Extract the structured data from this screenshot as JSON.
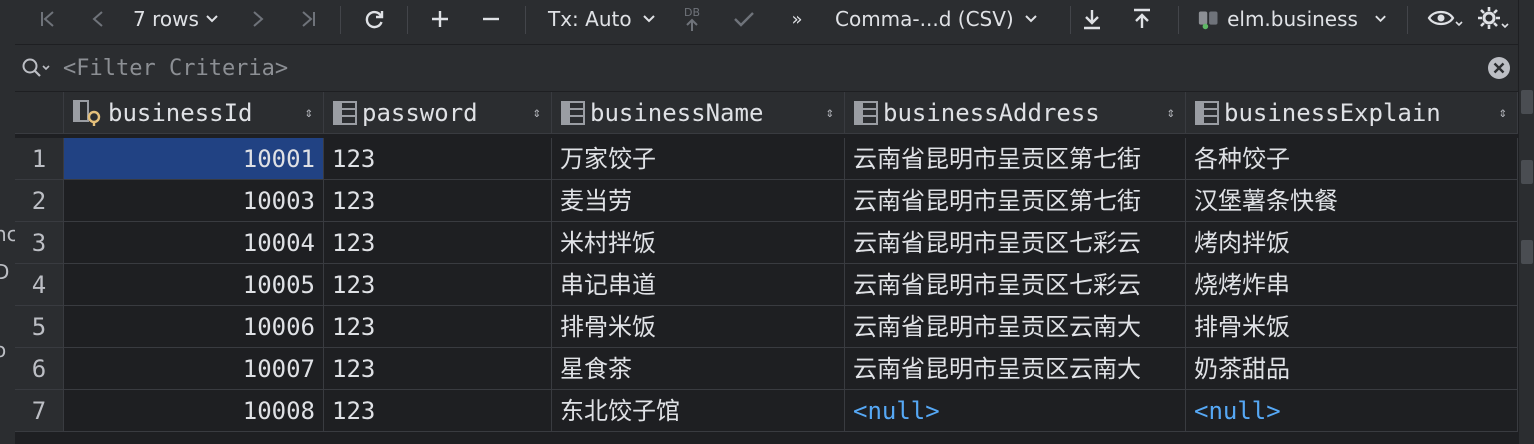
{
  "toolbar": {
    "rows_label": "7 rows",
    "tx_label": "Tx: Auto",
    "db_label": "DB",
    "more_label": "»",
    "format_label": "Comma-...d (CSV)",
    "datasource_label": "elm.business"
  },
  "filter": {
    "placeholder": "<Filter Criteria>"
  },
  "columns": [
    {
      "label": "businessId",
      "icon": "primary-key-column-icon"
    },
    {
      "label": "password",
      "icon": "column-icon"
    },
    {
      "label": "businessName",
      "icon": "column-icon"
    },
    {
      "label": "businessAddress",
      "icon": "column-icon"
    },
    {
      "label": "businessExplain",
      "icon": "column-icon"
    }
  ],
  "rows": [
    {
      "n": "1",
      "id": "10001",
      "pw": "123",
      "name": "万家饺子",
      "addr": "云南省昆明市呈贡区第七街",
      "explain": "各种饺子"
    },
    {
      "n": "2",
      "id": "10003",
      "pw": "123",
      "name": "麦当劳",
      "addr": "云南省昆明市呈贡区第七街",
      "explain": "汉堡薯条快餐"
    },
    {
      "n": "3",
      "id": "10004",
      "pw": "123",
      "name": "米村拌饭",
      "addr": "云南省昆明市呈贡区七彩云",
      "explain": "烤肉拌饭"
    },
    {
      "n": "4",
      "id": "10005",
      "pw": "123",
      "name": "串记串道",
      "addr": "云南省昆明市呈贡区七彩云",
      "explain": "烧烤炸串"
    },
    {
      "n": "5",
      "id": "10006",
      "pw": "123",
      "name": "排骨米饭",
      "addr": "云南省昆明市呈贡区云南大",
      "explain": "排骨米饭"
    },
    {
      "n": "6",
      "id": "10007",
      "pw": "123",
      "name": "星食茶",
      "addr": "云南省昆明市呈贡区云南大",
      "explain": "奶茶甜品"
    },
    {
      "n": "7",
      "id": "10008",
      "pw": "123",
      "name": "东北饺子馆",
      "addr": "<null>",
      "explain": "<null>"
    }
  ],
  "left_strip_fragments": [
    "nc",
    "D",
    "o"
  ],
  "colors": {
    "selection": "#214283",
    "null_value": "#56a8f5"
  }
}
